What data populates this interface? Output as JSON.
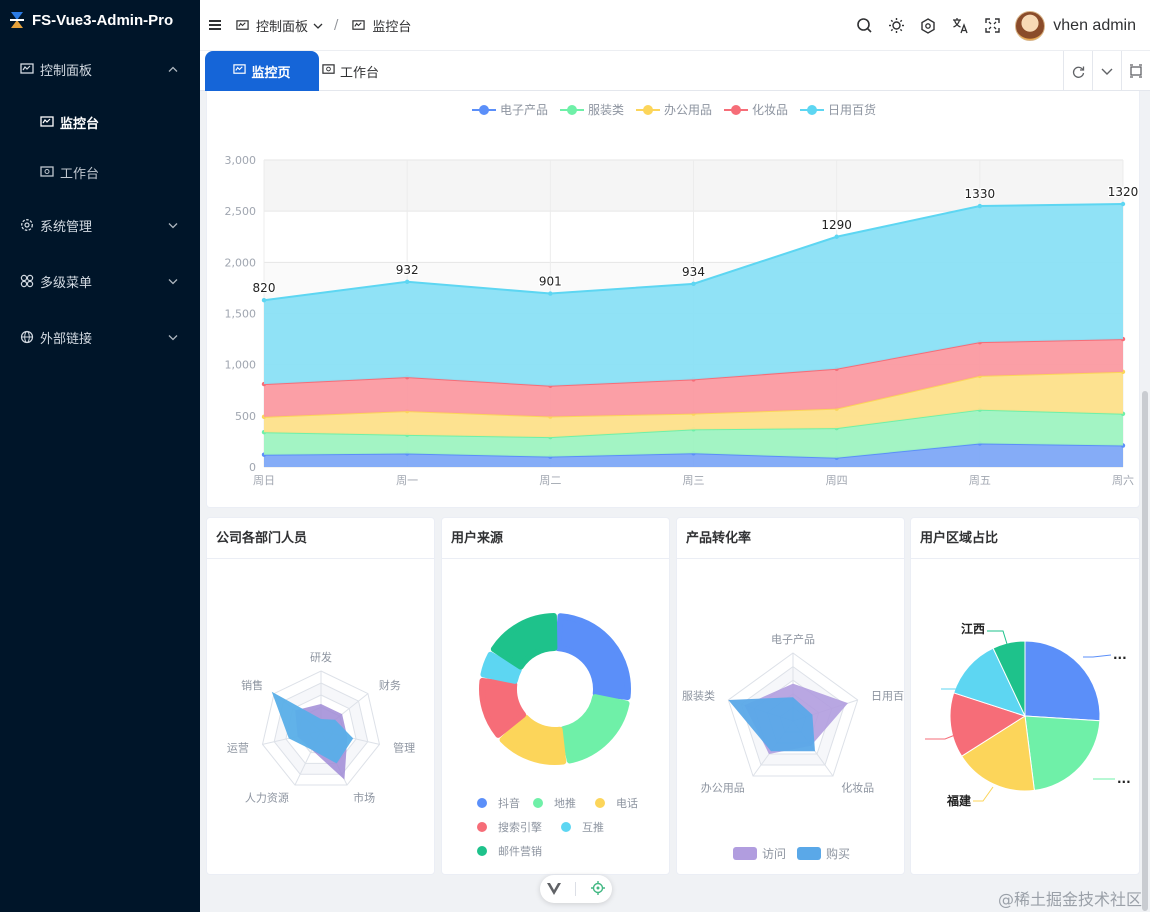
{
  "app": {
    "title": "FS-Vue3-Admin-Pro"
  },
  "sidebar": {
    "items": [
      {
        "label": "控制面板",
        "icon": "dashboard-icon",
        "expanded": true
      },
      {
        "label": "监控台",
        "icon": "monitor-icon",
        "sub": true,
        "active": true
      },
      {
        "label": "工作台",
        "icon": "workbench-icon",
        "sub": true
      },
      {
        "label": "系统管理",
        "icon": "gear-icon"
      },
      {
        "label": "多级菜单",
        "icon": "grid-icon"
      },
      {
        "label": "外部链接",
        "icon": "globe-icon"
      }
    ]
  },
  "header": {
    "breadcrumb": [
      "控制面板",
      "监控台"
    ],
    "user": "vhen admin"
  },
  "tabs": {
    "active": "监控页",
    "other": "工作台"
  },
  "colors": {
    "electronics": "#5470c6",
    "clothing": "#91cc75",
    "office": "#fac858",
    "cosmetics": "#ee6666",
    "daily": "#73c0de",
    "purple": "#b19ddf",
    "blue": "#5aa8e8",
    "green": "#1ec28b"
  },
  "chart_data": [
    {
      "type": "area",
      "stacked": true,
      "legend": [
        "电子产品",
        "服装类",
        "办公用品",
        "化妆品",
        "日用百货"
      ],
      "categories": [
        "周日",
        "周一",
        "周二",
        "周三",
        "周四",
        "周五",
        "周六"
      ],
      "series": [
        {
          "name": "电子产品",
          "values": [
            120,
            132,
            101,
            134,
            90,
            230,
            210
          ]
        },
        {
          "name": "服装类",
          "values": [
            220,
            182,
            191,
            234,
            290,
            330,
            310
          ]
        },
        {
          "name": "办公用品",
          "values": [
            150,
            232,
            201,
            154,
            190,
            330,
            410
          ]
        },
        {
          "name": "化妆品",
          "values": [
            320,
            332,
            301,
            334,
            390,
            330,
            320
          ]
        },
        {
          "name": "日用百货",
          "values": [
            820,
            932,
            901,
            934,
            1290,
            1330,
            1320
          ]
        }
      ],
      "data_labels": [
        "820",
        "932",
        "901",
        "934",
        "1290",
        "1330",
        "1320"
      ],
      "yticks": [
        "0",
        "500",
        "1,000",
        "1,500",
        "2,000",
        "2,500",
        "3,000"
      ],
      "ylim": [
        0,
        3000
      ],
      "grid": true,
      "legend_position": "top"
    },
    {
      "type": "radar",
      "title": "公司各部门人员",
      "indicators": [
        "研发",
        "财务",
        "管理",
        "市场",
        "人力资源",
        "运营",
        "销售"
      ]
    },
    {
      "type": "donut",
      "title": "用户来源",
      "legend": [
        "抖音",
        "地推",
        "电话",
        "搜索引擎",
        "互推",
        "邮件营销"
      ],
      "values": [
        27,
        20,
        16,
        14,
        6,
        17
      ]
    },
    {
      "type": "radar",
      "title": "产品转化率",
      "indicators": [
        "电子产品",
        "日用百",
        "化妆品",
        "办公用品",
        "服装类"
      ],
      "legend": [
        "访问",
        "购买"
      ]
    },
    {
      "type": "pie",
      "title": "用户区域占比",
      "labels": [
        "江西",
        "福建",
        "...",
        "..."
      ],
      "values": [
        26,
        22,
        18,
        14,
        13,
        7
      ]
    }
  ],
  "footer": {
    "watermark": "@稀土掘金技术社区"
  }
}
